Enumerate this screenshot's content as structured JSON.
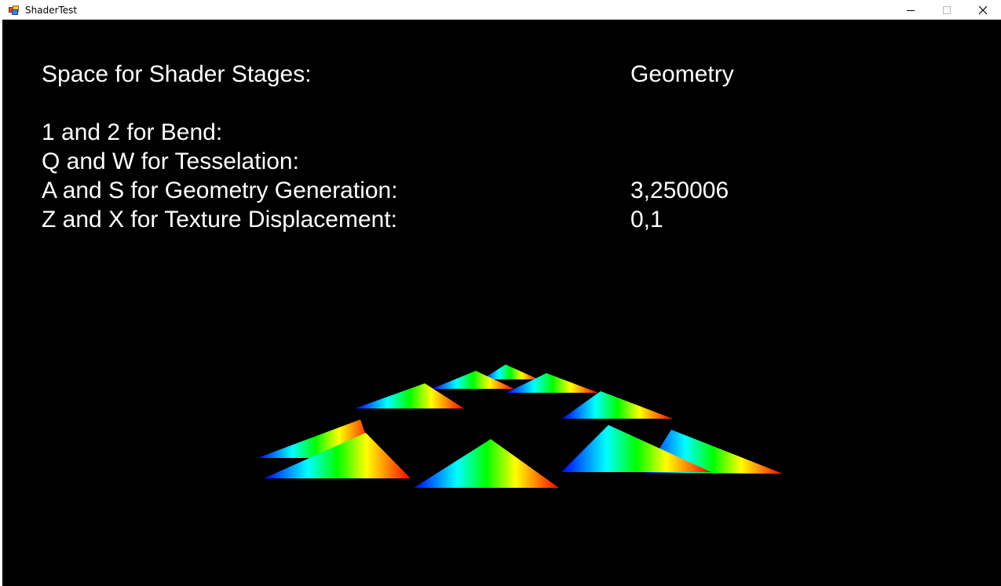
{
  "window": {
    "title": "ShaderTest"
  },
  "hud": {
    "stages_label": "Space for Shader Stages:",
    "stages_value": "Geometry",
    "bend_label": "1 and 2 for Bend:",
    "tessellation_label": "Q and W for Tesselation:",
    "geometry_label": "A and S for Geometry Generation:",
    "geometry_value": "3,250006",
    "displacement_label": "Z and X for Texture Displacement:",
    "displacement_value": "0,1"
  },
  "colors": {
    "background": "#000000",
    "text": "#ffffff",
    "gradient": [
      "#0000ff",
      "#00ffff",
      "#00ff00",
      "#ffff00",
      "#ff0000"
    ]
  },
  "icons": {
    "app": "app-icon",
    "minimize": "minimize-icon",
    "maximize": "maximize-icon",
    "close": "close-icon"
  }
}
